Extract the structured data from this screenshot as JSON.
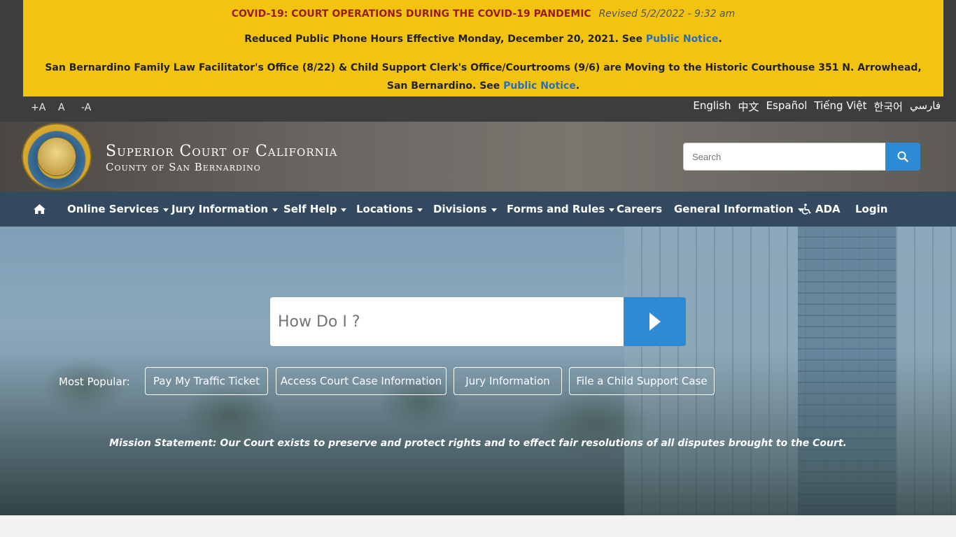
{
  "alert": {
    "covid_title": "COVID-19: COURT OPERATIONS DURING THE COVID-19 PANDEMIC",
    "revised": "Revised 5/2/2022 - 9:32 am",
    "line2_text": "Reduced Public Phone Hours Effective Monday, December 20, 2021. See",
    "line2_link": "Public Notice",
    "line3_text": "San Bernardino Family Law Facilitator's Office (8/22) & Child Support Clerk's Office/Courtrooms (9/6) are Moving to the Historic Courthouse 351 N. Arrowhead, San Bernardino. See",
    "line3_link": "Public Notice",
    "period": "."
  },
  "font_controls": {
    "increase": "+A",
    "normal": "A",
    "decrease": "-A"
  },
  "languages": [
    "English",
    "中文",
    "Español",
    "Tiếng Việt",
    "한국어",
    "فارسي"
  ],
  "header": {
    "title": "Superior Court of California",
    "subtitle": "County of San Bernardino",
    "search_placeholder": "Search"
  },
  "nav": {
    "items": [
      {
        "label": "Online Services",
        "dropdown": true
      },
      {
        "label": "Jury Information",
        "dropdown": true
      },
      {
        "label": "Self Help",
        "dropdown": true
      },
      {
        "label": "Locations",
        "dropdown": true
      },
      {
        "label": "Divisions",
        "dropdown": true
      },
      {
        "label": "Forms and Rules",
        "dropdown": true
      },
      {
        "label": "Careers",
        "dropdown": false
      },
      {
        "label": "General Information",
        "dropdown": true
      },
      {
        "label": "ADA",
        "dropdown": false
      },
      {
        "label": "Login",
        "dropdown": false
      }
    ]
  },
  "hero": {
    "howdo_placeholder": "How Do I ?",
    "popular_label": "Most Popular:",
    "popular": [
      "Pay My Traffic Ticket",
      "Access Court Case Information",
      "Jury Information",
      "File a Child Support Case"
    ],
    "mission": "Mission Statement: Our Court exists to preserve and protect rights and to effect fair resolutions of all disputes brought to the Court."
  },
  "colors": {
    "alert_bg": "#f2c311",
    "alert_title": "#9a1e16",
    "link": "#2a6eb5",
    "nav_bg": "#33495f",
    "accent": "#2d8ad4"
  }
}
